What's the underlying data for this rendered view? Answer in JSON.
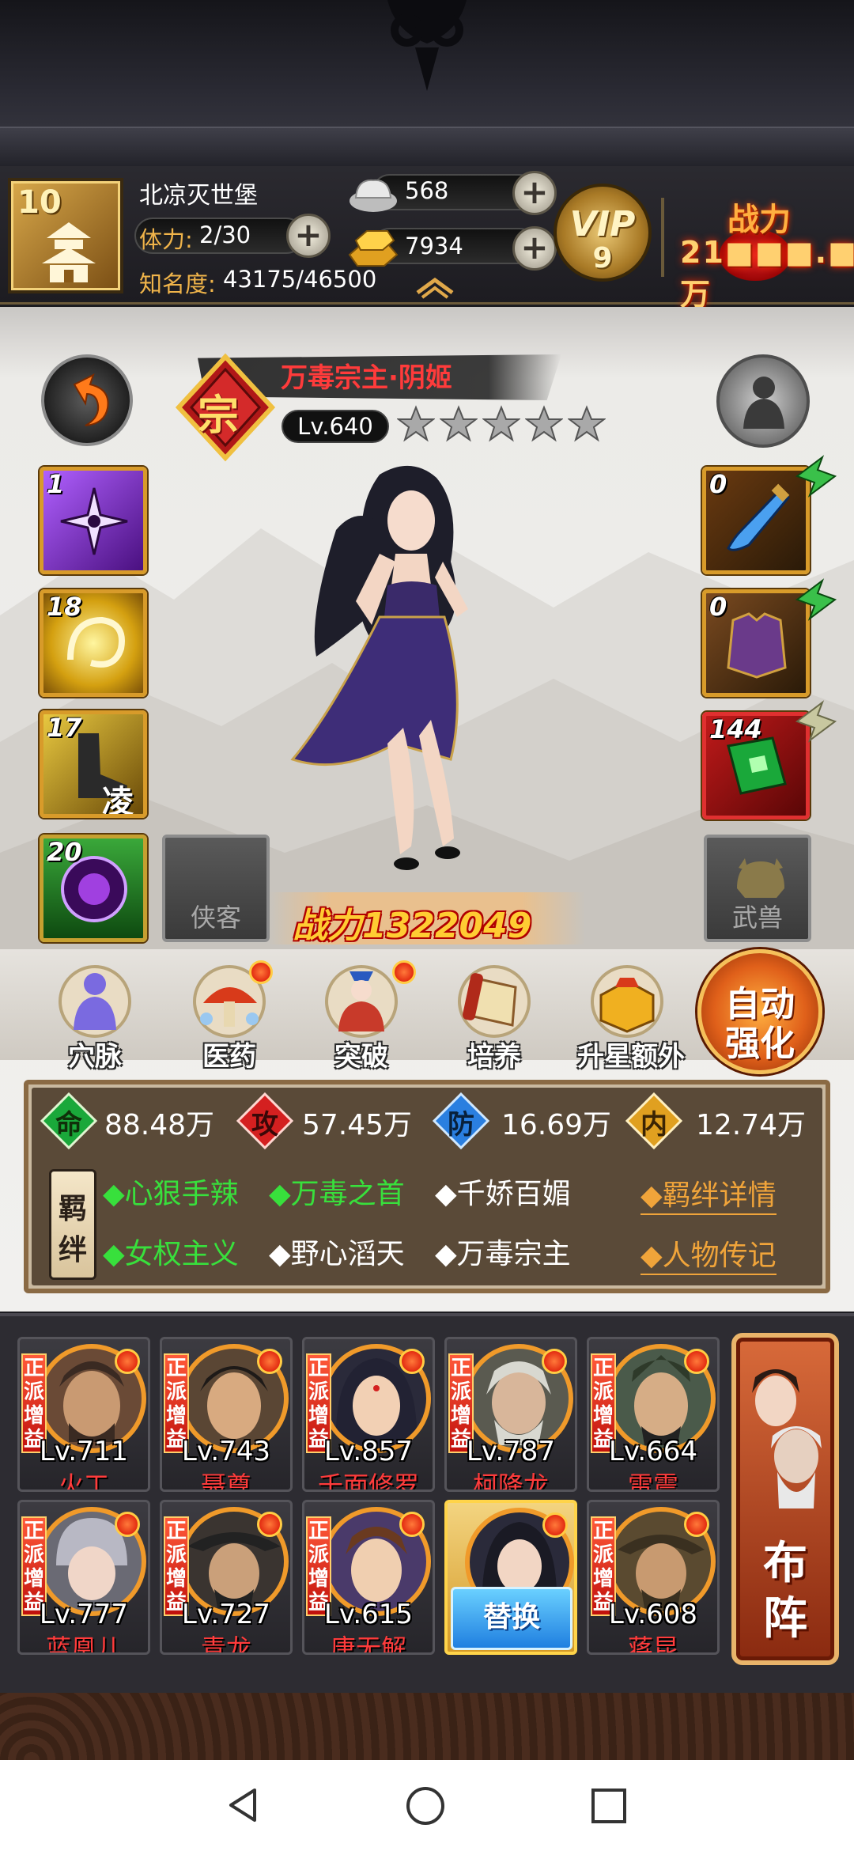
{
  "header": {
    "player_level": "10",
    "player_name": "北凉灭世堡",
    "stamina_label": "体力:",
    "stamina_value": "2/30",
    "fame_label": "知名度:",
    "fame_value": "43175/46500",
    "silver": "568",
    "gold": "7934",
    "vip_label": "VIP",
    "vip_level": "9",
    "power_label": "战力",
    "power_value": "21■■■.■万"
  },
  "hero": {
    "name": "万毒宗主·阴姬",
    "rarity": "宗",
    "level": "Lv.640",
    "stars_total": 5,
    "stars_filled": 0,
    "combat_power": "战力1322049"
  },
  "left_slots": [
    {
      "name": "skill-slot-1",
      "count": "1"
    },
    {
      "name": "skill-slot-2",
      "count": "18"
    },
    {
      "name": "skill-slot-3",
      "count": "17",
      "glyph": "凌"
    },
    {
      "name": "skill-slot-4",
      "count": "20"
    }
  ],
  "right_slots": [
    {
      "name": "weapon-slot",
      "count": "0"
    },
    {
      "name": "armor-slot",
      "count": "0"
    },
    {
      "name": "book-slot",
      "count": "144"
    }
  ],
  "empty_slots": {
    "companion": "侠客",
    "beast": "武兽"
  },
  "actions": [
    {
      "label": "穴脉",
      "dot": false
    },
    {
      "label": "医药",
      "dot": true
    },
    {
      "label": "突破",
      "dot": true
    },
    {
      "label": "培养",
      "dot": false
    },
    {
      "label": "升星额外",
      "dot": false
    }
  ],
  "auto_strengthen": {
    "line1": "自动",
    "line2": "强化"
  },
  "stats": [
    {
      "icon": "命",
      "value": "88.48万",
      "color": "#1aa83a"
    },
    {
      "icon": "攻",
      "value": "57.45万",
      "color": "#d42020"
    },
    {
      "icon": "防",
      "value": "16.69万",
      "color": "#2a7fe0"
    },
    {
      "icon": "内",
      "value": "12.74万",
      "color": "#e0a020"
    }
  ],
  "bond_tag": {
    "c1": "羁",
    "c2": "绊"
  },
  "bonds_row1": [
    {
      "text": "◆心狠手辣",
      "active": true
    },
    {
      "text": "◆万毒之首",
      "active": true
    },
    {
      "text": "◆千娇百媚",
      "active": false
    }
  ],
  "bonds_row2": [
    {
      "text": "◆女权主义",
      "active": true
    },
    {
      "text": "◆野心滔天",
      "active": false
    },
    {
      "text": "◆万毒宗主",
      "active": false
    }
  ],
  "bond_links": {
    "details": "◆羁绊详情",
    "biography": "◆人物传记"
  },
  "team_tag": "正派增益",
  "team": [
    {
      "level": "Lv.711",
      "name": "火工",
      "skin": "#c99a72",
      "hair": "#3a2a22"
    },
    {
      "level": "Lv.743",
      "name": "聂尊",
      "skin": "#d8aa80",
      "hair": "#1e1a18"
    },
    {
      "level": "Lv.857",
      "name": "千面修罗",
      "skin": "#f2d0b4",
      "hair": "#222233"
    },
    {
      "level": "Lv.787",
      "name": "柯降龙",
      "skin": "#d8b69a",
      "hair": "#d8d8d0"
    },
    {
      "level": "Lv.664",
      "name": "雷震",
      "skin": "#d6ad86",
      "hair": "#2e3a2a"
    },
    {
      "level": "Lv.777",
      "name": "蓝凰儿",
      "skin": "#f0d6c8",
      "hair": "#b8b8c4"
    },
    {
      "level": "Lv.727",
      "name": "青龙",
      "skin": "#caa07a",
      "hair": "#222"
    },
    {
      "level": "Lv.615",
      "name": "唐无解",
      "skin": "#f0cfb0",
      "hair": "#6a3a20"
    },
    {
      "level": "",
      "name": "",
      "skin": "#f2d6c4",
      "hair": "#1a1a24"
    },
    {
      "level": "Lv.608",
      "name": "蒋昆",
      "skin": "#c89a70",
      "hair": "#3a3020"
    }
  ],
  "replace_label": "替换",
  "formation": {
    "c1": "布",
    "c2": "阵"
  },
  "colors": {
    "accent_gold": "#f0b44a",
    "hero_name_red": "#ff3b3b",
    "bond_active": "#38e03c",
    "bond_link": "#f0a43a"
  }
}
